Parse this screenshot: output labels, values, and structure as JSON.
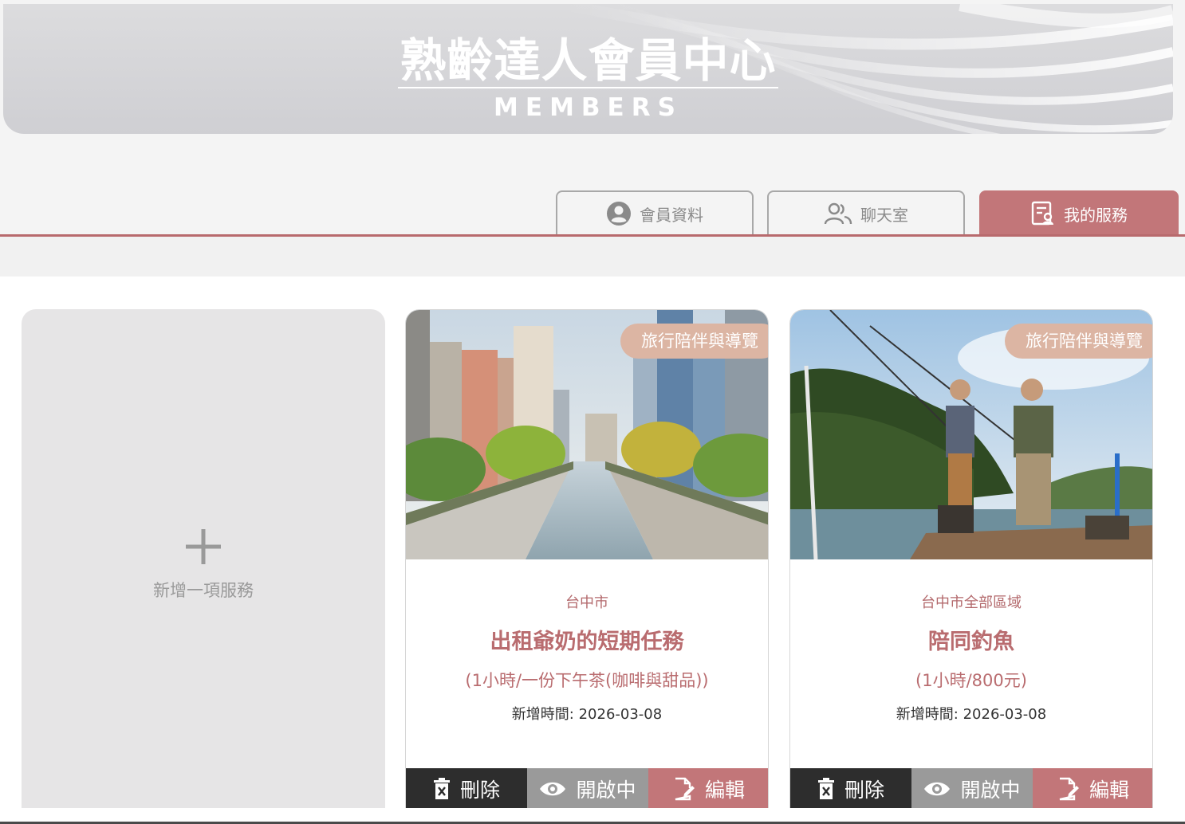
{
  "banner": {
    "title": "熟齡達人會員中心",
    "subtitle": "MEMBERS"
  },
  "tabs": [
    {
      "label": "會員資料",
      "icon": "user-circle-icon",
      "active": false
    },
    {
      "label": "聊天室",
      "icon": "users-icon",
      "active": false
    },
    {
      "label": "我的服務",
      "icon": "service-list-icon",
      "active": true
    }
  ],
  "add_service": {
    "label": "新增一項服務"
  },
  "services": [
    {
      "badge": "旅行陪伴與導覽",
      "location": "台中市",
      "title": "出租爺奶的短期任務",
      "price": "(1小時/一份下午茶(咖啡與甜品))",
      "date": "新增時間: 2026-03-08",
      "image": "city-canal-photo",
      "actions": {
        "delete": "刪除",
        "open": "開啟中",
        "edit": "編輯"
      }
    },
    {
      "badge": "旅行陪伴與導覽",
      "location": "台中市全部區域",
      "title": "陪同釣魚",
      "price": "(1小時/800元)",
      "date": "新增時間: 2026-03-08",
      "image": "fishing-photo",
      "actions": {
        "delete": "刪除",
        "open": "開啟中",
        "edit": "編輯"
      }
    }
  ],
  "colors": {
    "accent": "#c27679",
    "badge": "#dcb5a3",
    "dark": "#2d2d2d",
    "gray": "#9a9a9a"
  }
}
